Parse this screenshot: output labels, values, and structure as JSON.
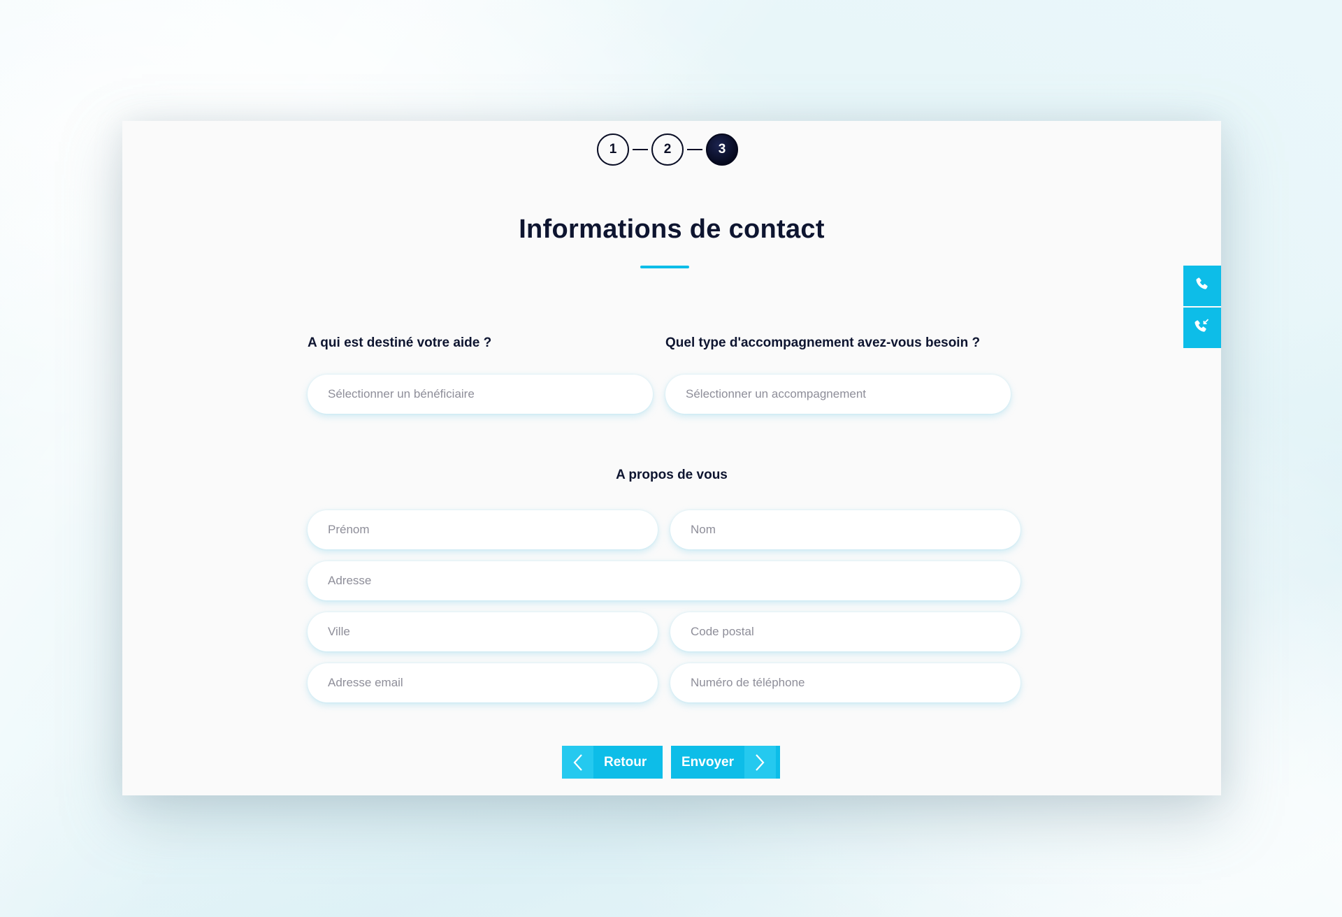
{
  "stepper": {
    "steps": [
      "1",
      "2",
      "3"
    ],
    "active_step": "3"
  },
  "page": {
    "title": "Informations de contact"
  },
  "questions": {
    "beneficiary": {
      "label": "A qui est destiné votre aide ?",
      "placeholder": "Sélectionner un bénéficiaire"
    },
    "support_type": {
      "label": "Quel type d'accompagnement avez-vous besoin ?",
      "placeholder": "Sélectionner un accompagnement"
    }
  },
  "about": {
    "label": "A propos de vous",
    "fields": {
      "first_name": "Prénom",
      "last_name": "Nom",
      "address": "Adresse",
      "city": "Ville",
      "postal_code": "Code postal",
      "email": "Adresse email",
      "phone": "Numéro de téléphone"
    }
  },
  "buttons": {
    "back": "Retour",
    "send": "Envoyer"
  },
  "side_tabs": {
    "call": "phone-icon",
    "callback": "phone-incoming-icon"
  },
  "colors": {
    "accent": "#0dbde8",
    "text_dark": "#0e1530",
    "placeholder": "#8e8e99"
  }
}
